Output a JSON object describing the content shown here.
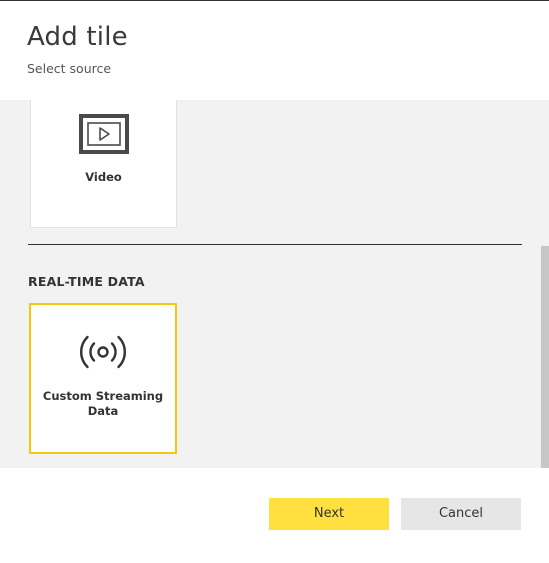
{
  "dialog": {
    "title": "Add tile",
    "subtitle": "Select source"
  },
  "tiles": {
    "video": {
      "label": "Video",
      "icon": "video-play-icon"
    }
  },
  "sections": {
    "realtime": {
      "heading": "REAL-TIME DATA",
      "tiles": [
        {
          "label": "Custom Streaming Data",
          "icon": "streaming-broadcast-icon",
          "selected": true
        }
      ]
    }
  },
  "footer": {
    "next_label": "Next",
    "cancel_label": "Cancel"
  },
  "colors": {
    "accent": "#f2c811",
    "next_button": "#ffe03f",
    "cancel_button": "#e6e6e6",
    "content_background": "#f2f2f2"
  }
}
